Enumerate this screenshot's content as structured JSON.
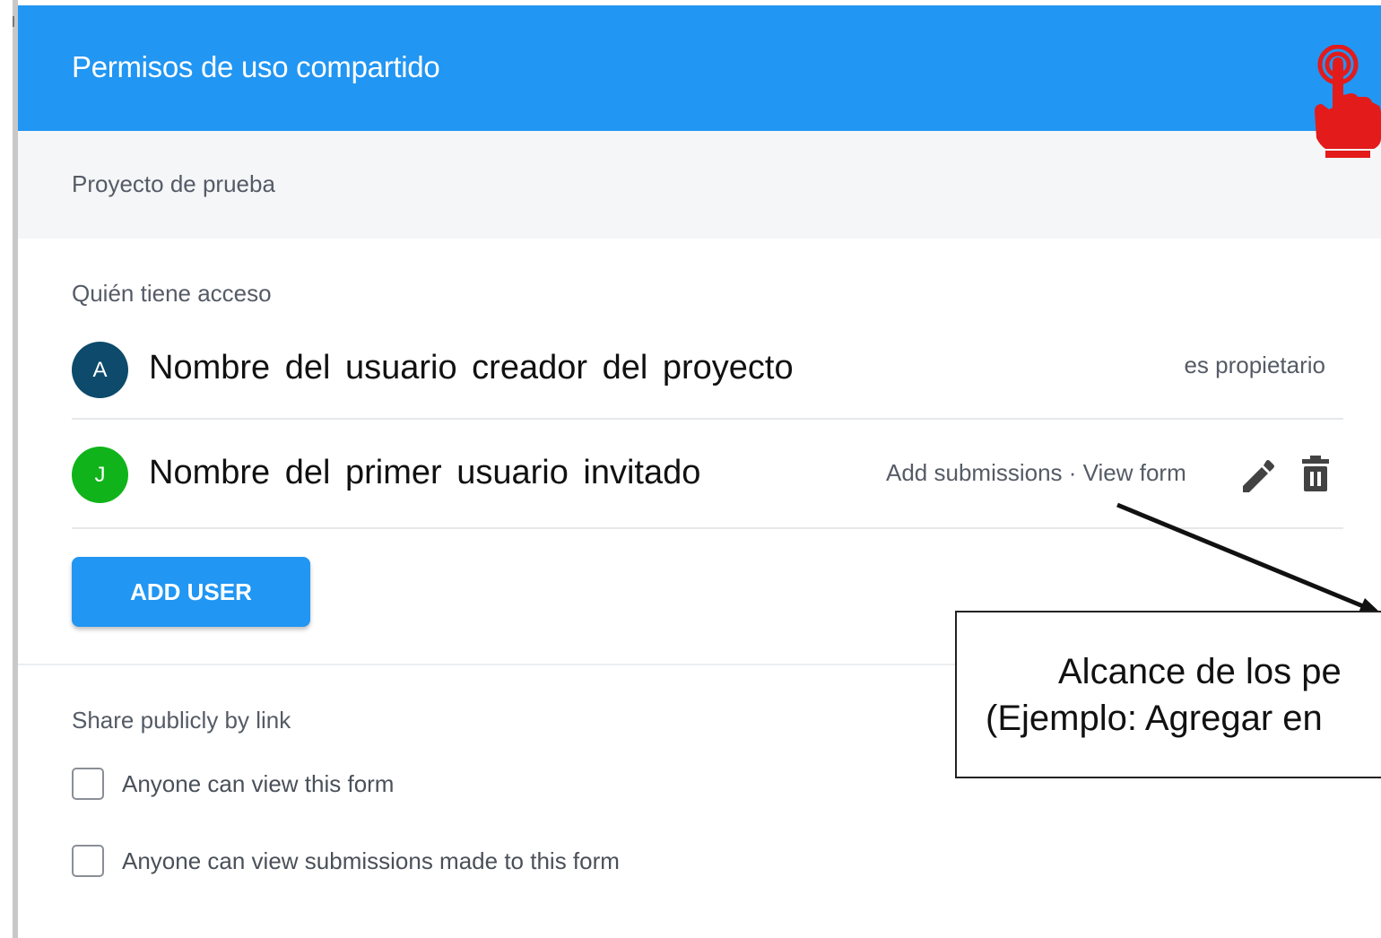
{
  "dialog": {
    "title": "Permisos de uso compartido",
    "project_name": "Proyecto de prueba"
  },
  "access": {
    "section_label": "Quién tiene acceso",
    "users": [
      {
        "initial": "A",
        "name": "Nombre del usuario creador del proyecto",
        "role": "es propietario",
        "avatar_color": "#0d4a6b"
      },
      {
        "initial": "J",
        "name": "Nombre del primer usuario invitado",
        "role": "Add submissions · View form",
        "avatar_color": "#10b41a"
      }
    ],
    "add_user_label": "ADD USER"
  },
  "public_share": {
    "section_label": "Share publicly by link",
    "options": [
      {
        "label": "Anyone can view this form",
        "checked": false
      },
      {
        "label": "Anyone can view submissions made to this form",
        "checked": false
      }
    ]
  },
  "annotation": {
    "line1": "Alcance de los pe",
    "line2": "(Ejemplo: Agregar en",
    "pointer_icon": "hand-pointer-icon",
    "pointer_color": "#e31b1b"
  },
  "colors": {
    "header_bg": "#2196f3",
    "subheader_bg": "#f5f6f8"
  }
}
